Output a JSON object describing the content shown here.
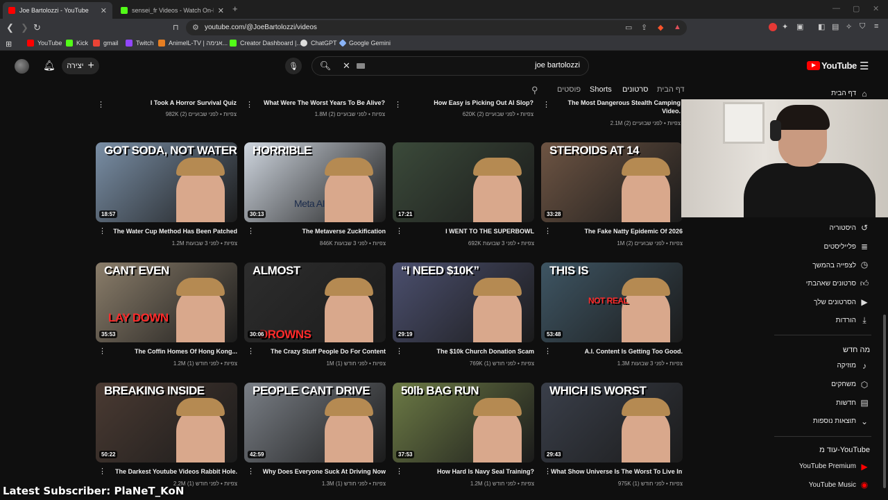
{
  "browser": {
    "tabs": [
      {
        "title": "Joe Bartolozzi - YouTube",
        "active": true,
        "favicon_color": "#ff0000"
      },
      {
        "title": "sensei_fr Videos - Watch On-Demand",
        "active": false,
        "favicon_color": "#53fc18"
      }
    ],
    "url": "youtube.com/@JoeBartolozzi/videos",
    "bookmarks": [
      {
        "label": "YouTube",
        "color": "#ff0000"
      },
      {
        "label": "Kick",
        "color": "#53fc18"
      },
      {
        "label": "gmail",
        "color": "#ea4335"
      },
      {
        "label": "Twitch",
        "color": "#9146ff"
      },
      {
        "label": "AnimelL-TV | אנימה...",
        "color": "#e67e22"
      },
      {
        "label": "Creator Dashboard |...",
        "color": "#53fc18"
      },
      {
        "label": "ChatGPT",
        "color": "#dddddd"
      },
      {
        "label": "Google Gemini",
        "color": "#8ab4f8"
      }
    ]
  },
  "masthead": {
    "create_label": "יצירה",
    "search_query": "joe bartolozzi",
    "logo_text": "YouTube"
  },
  "channel_tabs": {
    "home": "דף הבית",
    "videos": "סרטונים",
    "shorts": "Shorts",
    "posts": "פוסטים"
  },
  "sidebar": {
    "home": "דף הבית",
    "history": "היסטוריה",
    "playlists": "פלייליסטים",
    "watch_later": "לצפייה בהמשך",
    "liked": "סרטונים שאהבתי",
    "your_videos": "הסרטונים שלך",
    "downloads": "הורדות",
    "explore_heading": "מה חדש",
    "music": "מוזיקה",
    "gaming": "משחקים",
    "news": "חדשות",
    "more_results": "תוצאות נוספות",
    "more_from_heading": "עוד מ-YouTube",
    "yt_premium": "YouTube Premium",
    "yt_music": "YouTube Music"
  },
  "top_row": [
    {
      "title": "I Took A Horror Survival Quiz",
      "meta": "982K צפיות • לפני שבועיים (2)"
    },
    {
      "title": "What Were The Worst Years To Be Alive?",
      "meta": "1.8M צפיות • לפני שבועיים (2)"
    },
    {
      "title": "How Easy is Picking Out AI Slop?",
      "meta": "620K צפיות • לפני שבועיים (2)"
    },
    {
      "title": "The Most Dangerous Stealth Camping",
      "title2": "Video.",
      "meta": "2.1M צפיות • לפני שבועיים (2)"
    }
  ],
  "videos": [
    {
      "title": "The Water Cup Method Has Been Patched",
      "meta": "1.2M צפיות • לפני 3 שבועות",
      "duration": "18:57",
      "overlay": "GOT SODA, NOT WATER",
      "bg": "#7a8fa6"
    },
    {
      "title": "The Metaverse Zuckification",
      "meta": "846K צפיות • לפני 3 שבועות",
      "duration": "30:13",
      "overlay": "HORRIBLE",
      "overlay2": "Meta AI",
      "bg": "#cfd6df"
    },
    {
      "title": "I WENT TO THE SUPERBOWL",
      "meta": "692K צפיות • לפני 3 שבועות",
      "duration": "17:21",
      "overlay": "",
      "bg": "#3b4a3a"
    },
    {
      "title": "The Fake Natty Epidemic Of 2026",
      "meta": "1M צפיות • לפני שבועיים (2)",
      "duration": "33:28",
      "overlay": "STEROIDS AT 14",
      "bg": "#6d5443"
    },
    {
      "title": "The Coffin Homes Of Hong Kong...",
      "meta": "1.2M צפיות • לפני חודש (1)",
      "duration": "35:53",
      "overlay": "CANT EVEN",
      "overlay2": "LAY DOWN",
      "bg": "#8a7d6a"
    },
    {
      "title": "The Crazy Stuff People Do For Content",
      "meta": "1M צפיות • לפני חודש (1)",
      "duration": "30:06",
      "overlay": "ALMOST",
      "overlay2": "DROWNS",
      "bg": "#2d2d2d"
    },
    {
      "title": "The $10k Church Donation Scam",
      "meta": "769K צפיות • לפני חודש (1)",
      "duration": "29:19",
      "overlay": "“I NEED $10K”",
      "bg": "#4b4f6e"
    },
    {
      "title": "A.I. Content Is Getting Too Good.",
      "meta": "1.3M צפיות • לפני 3 שבועות",
      "duration": "53:48",
      "overlay": "THIS IS",
      "overlay2": "NOT REAL",
      "bg": "#3e5563"
    },
    {
      "title": "The Darkest Youtube Videos Rabbit Hole.",
      "meta": "2.2M צפיות • לפני חודש (1)",
      "duration": "50:22",
      "overlay": "BREAKING INSIDE",
      "bg": "#4a3a32"
    },
    {
      "title": "Why Does Everyone Suck At Driving Now",
      "meta": "1.3M צפיות • לפני חודש (1)",
      "duration": "42:59",
      "overlay": "PEOPLE CANT DRIVE",
      "bg": "#7a7f86"
    },
    {
      "title": "How Hard Is Navy Seal Training?",
      "meta": "1.2M צפיות • לפני חודש (1)",
      "duration": "37:53",
      "overlay": "50lb BAG RUN",
      "bg": "#6c7a45"
    },
    {
      "title": "What Show Universe Is The Worst To Live In?",
      "meta": "975K צפיות • לפני חודש (1)",
      "duration": "29:43",
      "overlay": "WHICH IS WORST",
      "bg": "#3a3f4a"
    }
  ],
  "stream_overlay": {
    "subscriber_text": "Latest Subscriber: PlaNeT_KoN"
  },
  "colors": {
    "yt_red": "#ff0000",
    "overlay_red": "#ff2a2a",
    "background": "#0f0f0f"
  }
}
